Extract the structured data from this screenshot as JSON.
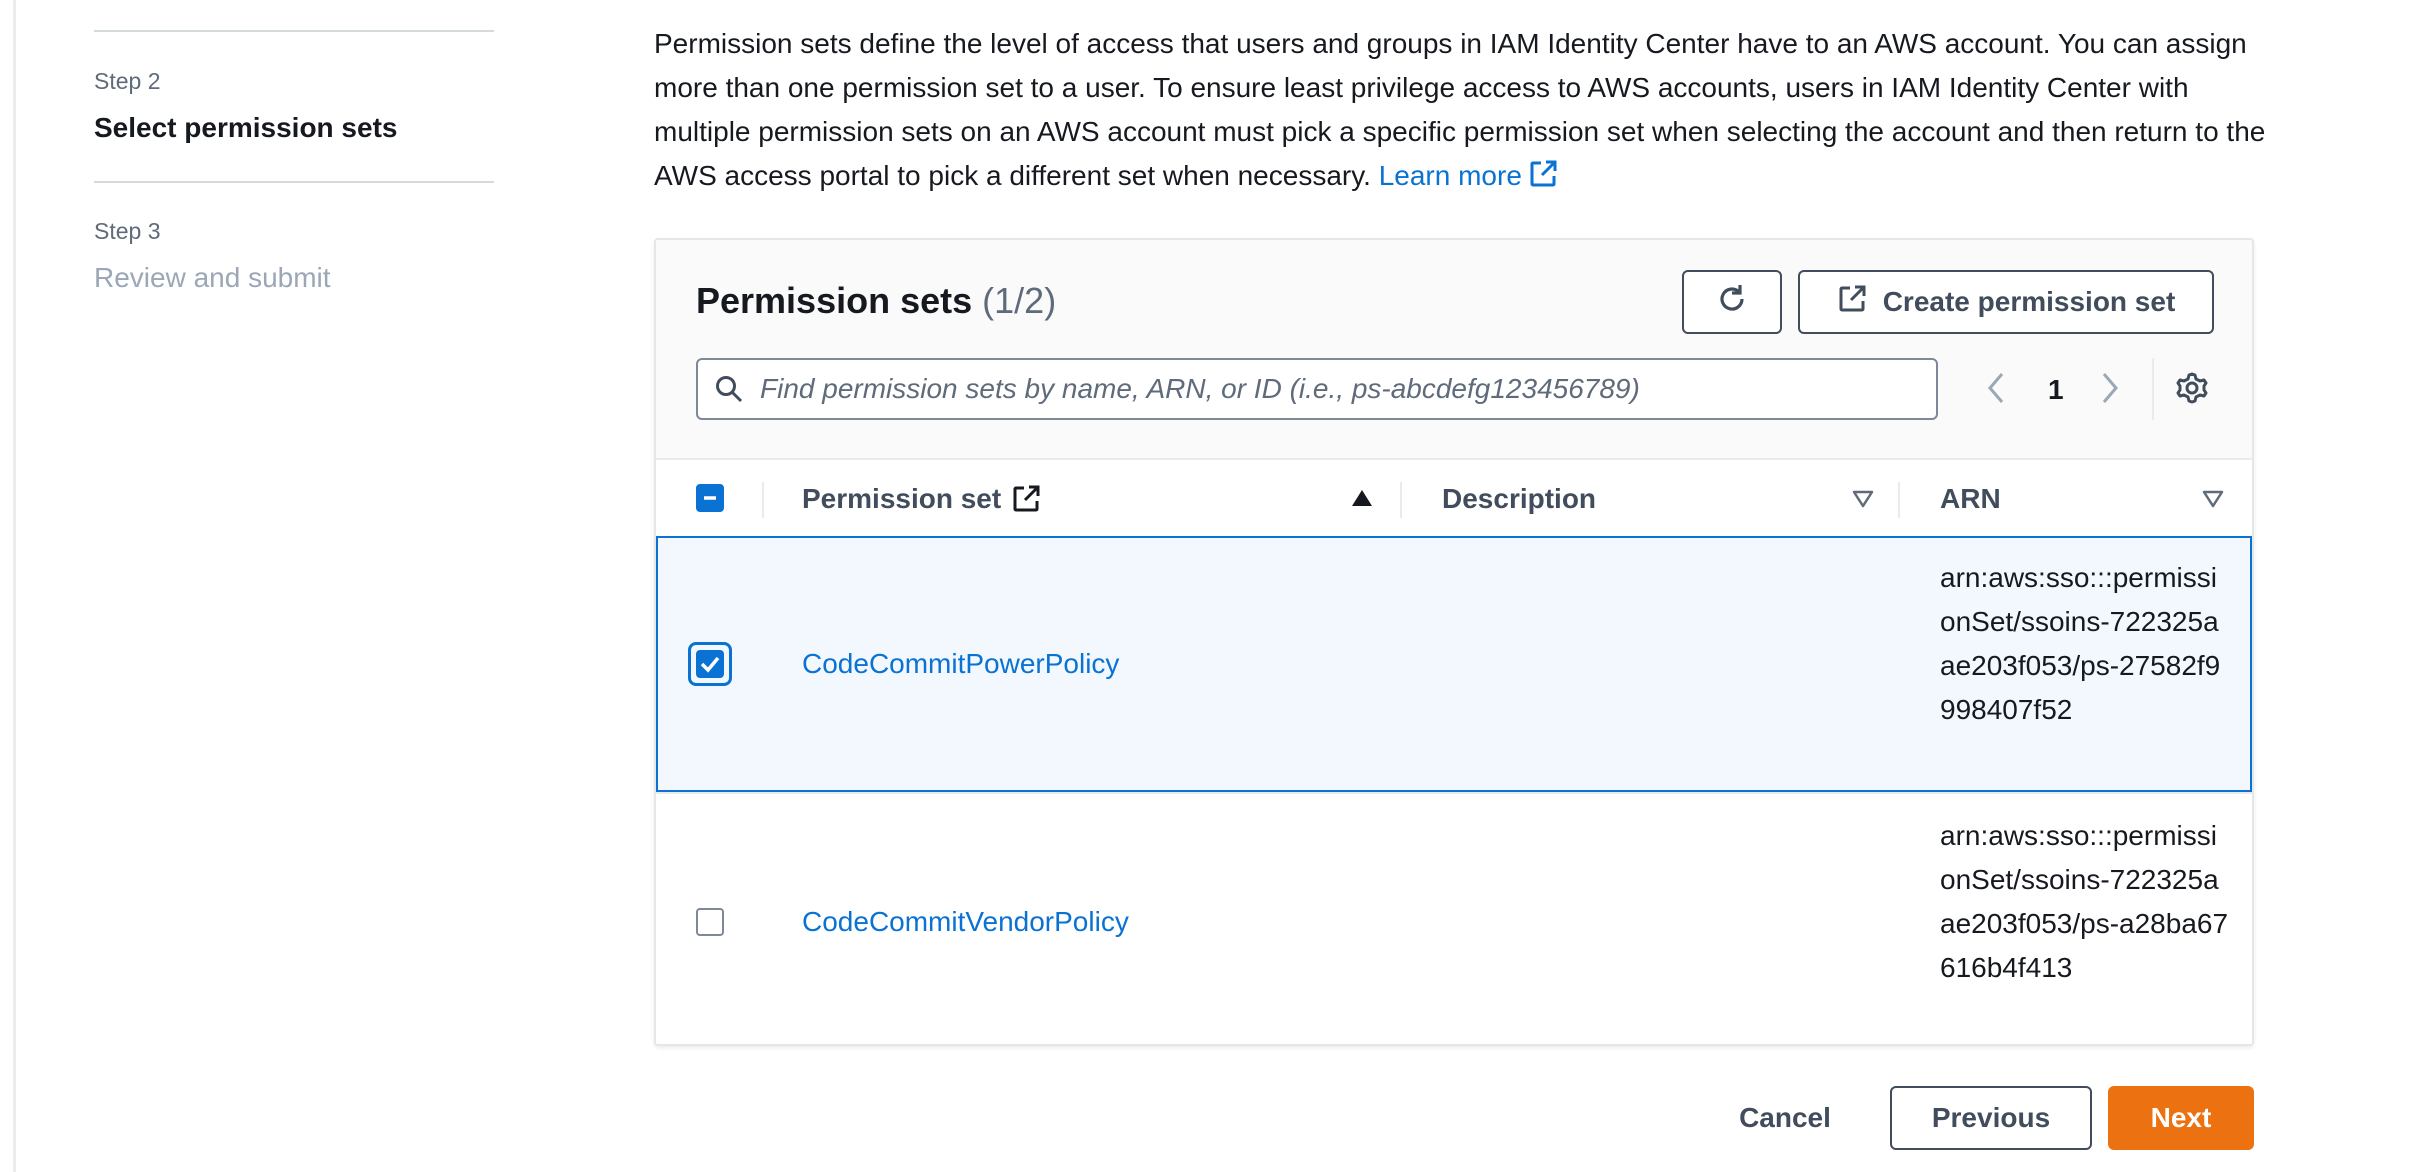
{
  "wizard": {
    "steps": [
      {
        "number": "Step 2",
        "title": "Select permission sets",
        "state": "active"
      },
      {
        "number": "Step 3",
        "title": "Review and submit",
        "state": "inactive"
      }
    ]
  },
  "intro": {
    "text": "Permission sets define the level of access that users and groups in IAM Identity Center have to an AWS account. You can assign more than one permission set to a user. To ensure least privilege access to AWS accounts, users in IAM Identity Center with multiple permission sets on an AWS account must pick a specific permission set when selecting the account and then return to the AWS access portal to pick a different set when necessary.",
    "learn_more": "Learn more"
  },
  "panel": {
    "title": "Permission sets",
    "count": "(1/2)",
    "create_label": "Create permission set",
    "search_placeholder": "Find permission sets by name, ARN, or ID (i.e., ps-abcdefg123456789)",
    "page": "1"
  },
  "table": {
    "columns": [
      "Permission set",
      "Description",
      "ARN"
    ],
    "rows": [
      {
        "name": "CodeCommitPowerPolicy",
        "description": "",
        "arn": "arn:aws:sso:::permissionSet/ssoins-722325aae203f053/ps-27582f9998407f52",
        "selected": true
      },
      {
        "name": "CodeCommitVendorPolicy",
        "description": "",
        "arn": "arn:aws:sso:::permissionSet/ssoins-722325aae203f053/ps-a28ba67616b4f413",
        "selected": false
      }
    ]
  },
  "footer": {
    "cancel": "Cancel",
    "previous": "Previous",
    "next": "Next"
  },
  "colors": {
    "link": "#0972d3",
    "primary_button": "#ec7211",
    "selected_row": "#f2f8fd"
  }
}
